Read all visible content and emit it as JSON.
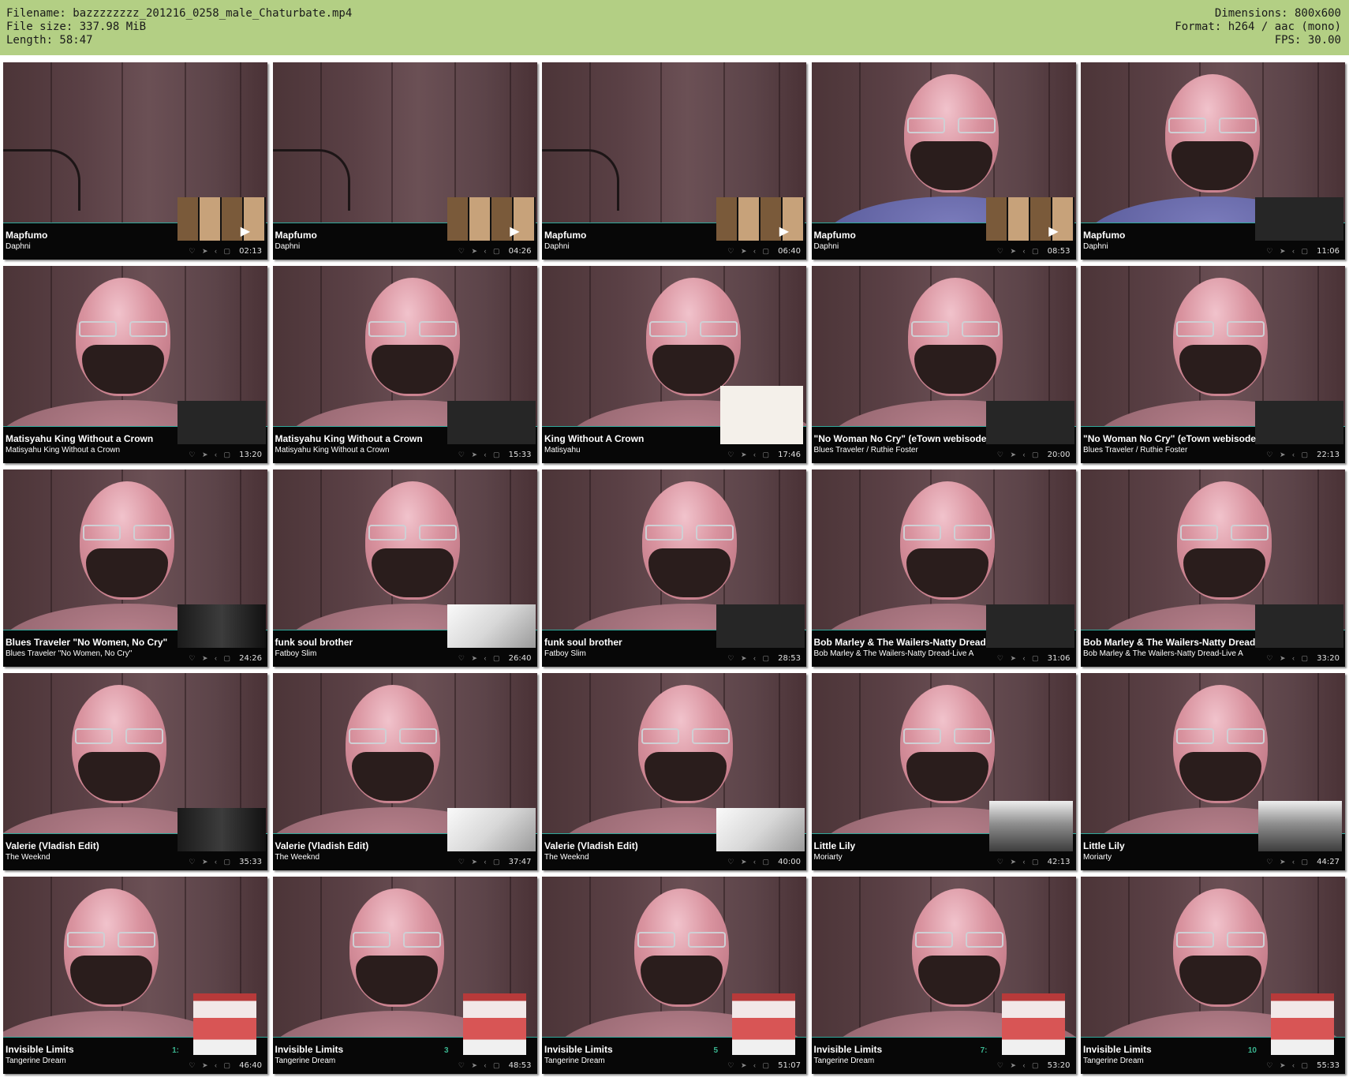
{
  "header": {
    "filename": "Filename: bazzzzzzzz_201216_0258_male_Chaturbate.mp4",
    "filesize": "File size: 337.98 MiB",
    "length": "Length: 58:47",
    "dimensions": "Dimensions: 800x600",
    "format": "Format: h264 / aac (mono)",
    "fps": "FPS: 30.00"
  },
  "thumbs": [
    {
      "title": "Mapfumo",
      "artist": "Daphni",
      "time": "02:13",
      "track": ""
    },
    {
      "title": "Mapfumo",
      "artist": "Daphni",
      "time": "04:26",
      "track": ""
    },
    {
      "title": "Mapfumo",
      "artist": "Daphni",
      "time": "06:40",
      "track": ""
    },
    {
      "title": "Mapfumo",
      "artist": "Daphni",
      "time": "08:53",
      "track": ""
    },
    {
      "title": "Mapfumo",
      "artist": "Daphni",
      "time": "11:06",
      "track": ""
    },
    {
      "title": "Matisyahu King Without a Crown",
      "artist": "Matisyahu King Without a Crown",
      "time": "13:20",
      "track": ""
    },
    {
      "title": "Matisyahu King Without a Crown",
      "artist": "Matisyahu King Without a Crown",
      "time": "15:33",
      "track": ""
    },
    {
      "title": "King Without A Crown",
      "artist": "Matisyahu",
      "time": "17:46",
      "track": ""
    },
    {
      "title": "\"No Woman No Cry\" (eTown webisode",
      "artist": "Blues Traveler / Ruthie Foster",
      "time": "20:00",
      "track": ""
    },
    {
      "title": "\"No Woman No Cry\" (eTown webisode",
      "artist": "Blues Traveler / Ruthie Foster",
      "time": "22:13",
      "track": ""
    },
    {
      "title": "Blues Traveler \"No Women, No Cry\"",
      "artist": "Blues Traveler \"No Women, No Cry\"",
      "time": "24:26",
      "track": ""
    },
    {
      "title": "funk soul brother",
      "artist": "Fatboy Slim",
      "time": "26:40",
      "track": ""
    },
    {
      "title": "funk soul brother",
      "artist": "Fatboy Slim",
      "time": "28:53",
      "track": ""
    },
    {
      "title": "Bob Marley & The Wailers-Natty Dread",
      "artist": "Bob Marley & The Wailers-Natty Dread-Live A",
      "time": "31:06",
      "track": ""
    },
    {
      "title": "Bob Marley & The Wailers-Natty Dread",
      "artist": "Bob Marley & The Wailers-Natty Dread-Live A",
      "time": "33:20",
      "track": ""
    },
    {
      "title": "Valerie (Vladish Edit)",
      "artist": "The Weeknd",
      "time": "35:33",
      "track": ""
    },
    {
      "title": "Valerie (Vladish Edit)",
      "artist": "The Weeknd",
      "time": "37:47",
      "track": ""
    },
    {
      "title": "Valerie (Vladish Edit)",
      "artist": "The Weeknd",
      "time": "40:00",
      "track": ""
    },
    {
      "title": "Little Lily",
      "artist": "Moriarty",
      "time": "42:13",
      "track": ""
    },
    {
      "title": "Little Lily",
      "artist": "Moriarty",
      "time": "44:27",
      "track": ""
    },
    {
      "title": "Invisible Limits",
      "artist": "Tangerine Dream",
      "time": "46:40",
      "track": "1:"
    },
    {
      "title": "Invisible Limits",
      "artist": "Tangerine Dream",
      "time": "48:53",
      "track": "3"
    },
    {
      "title": "Invisible Limits",
      "artist": "Tangerine Dream",
      "time": "51:07",
      "track": "5"
    },
    {
      "title": "Invisible Limits",
      "artist": "Tangerine Dream",
      "time": "53:20",
      "track": "7:"
    },
    {
      "title": "Invisible Limits",
      "artist": "Tangerine Dream",
      "time": "55:33",
      "track": "10"
    }
  ]
}
